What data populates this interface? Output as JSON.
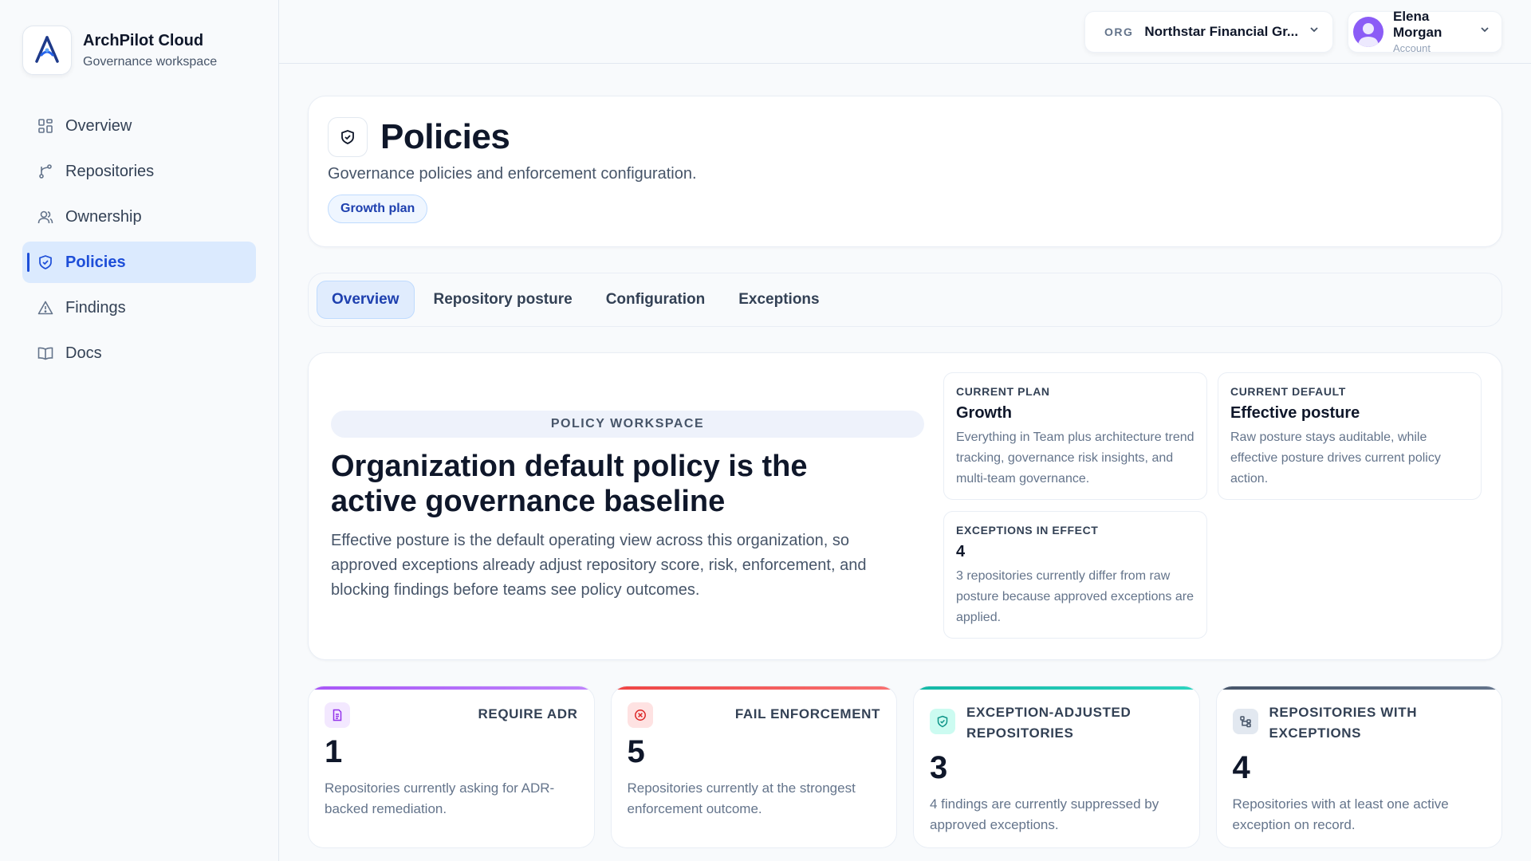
{
  "brand": {
    "name": "ArchPilot Cloud",
    "subtitle": "Governance workspace"
  },
  "sidebar": {
    "items": [
      {
        "label": "Overview",
        "icon": "grid-icon"
      },
      {
        "label": "Repositories",
        "icon": "branch-icon"
      },
      {
        "label": "Ownership",
        "icon": "users-icon"
      },
      {
        "label": "Policies",
        "icon": "shield-icon",
        "active": true
      },
      {
        "label": "Findings",
        "icon": "warning-icon"
      },
      {
        "label": "Docs",
        "icon": "book-icon"
      }
    ]
  },
  "topbar": {
    "org_tag": "ORG",
    "org_name": "Northstar Financial Gr...",
    "account_name": "Elena Morgan",
    "account_sub": "Account"
  },
  "header": {
    "title": "Policies",
    "description": "Governance policies and enforcement configuration.",
    "plan_badge": "Growth plan"
  },
  "tabs": [
    {
      "label": "Overview",
      "active": true
    },
    {
      "label": "Repository posture"
    },
    {
      "label": "Configuration"
    },
    {
      "label": "Exceptions"
    }
  ],
  "workspace": {
    "kicker": "POLICY WORKSPACE",
    "title": "Organization default policy is the active governance baseline",
    "body": "Effective posture is the default operating view across this organization, so approved exceptions already adjust repository score, risk, enforcement, and blocking findings before teams see policy outcomes.",
    "cards": [
      {
        "label": "CURRENT PLAN",
        "value": "Growth",
        "desc": "Everything in Team plus architecture trend tracking, governance risk insights, and multi-team governance."
      },
      {
        "label": "CURRENT DEFAULT",
        "value": "Effective posture",
        "desc": "Raw posture stays auditable, while effective posture drives current policy action."
      },
      {
        "label": "EXCEPTIONS IN EFFECT",
        "value": "4",
        "desc": "3 repositories currently differ from raw posture because approved exceptions are applied."
      }
    ]
  },
  "stats": [
    {
      "label": "REQUIRE ADR",
      "value": "1",
      "desc": "Repositories currently asking for ADR-backed remediation.",
      "accent": "#a855f7"
    },
    {
      "label": "FAIL ENFORCEMENT",
      "value": "5",
      "desc": "Repositories currently at the strongest enforcement outcome.",
      "accent": "#ef4444"
    },
    {
      "label": "EXCEPTION-ADJUSTED REPOSITORIES",
      "value": "3",
      "desc": "4 findings are currently suppressed by approved exceptions.",
      "accent": "#14b8a6"
    },
    {
      "label": "REPOSITORIES WITH EXCEPTIONS",
      "value": "4",
      "desc": "Repositories with at least one active exception on record.",
      "accent": "#475569"
    }
  ]
}
